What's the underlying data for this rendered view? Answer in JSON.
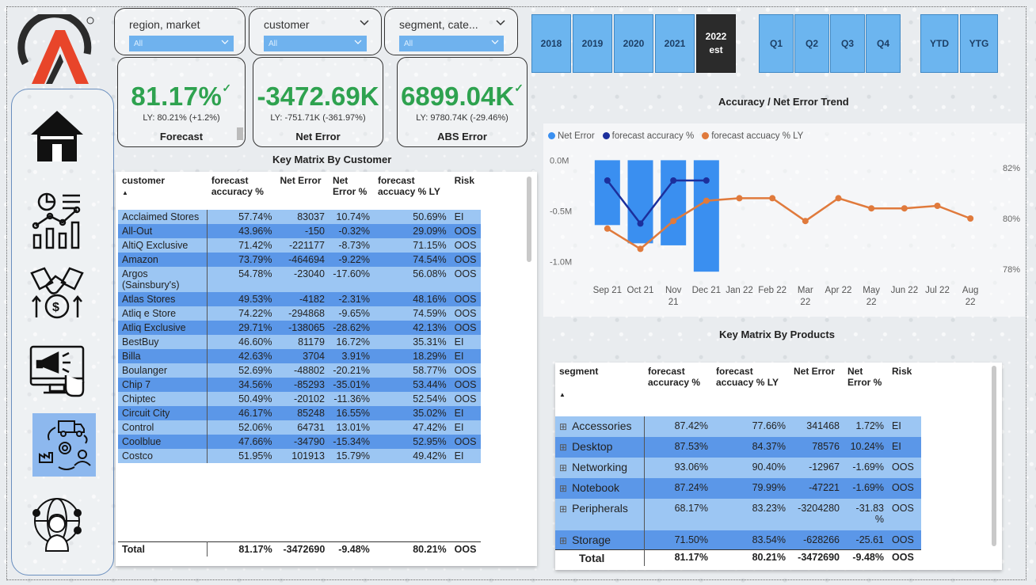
{
  "slicers": [
    {
      "label": "region, market",
      "value": "All"
    },
    {
      "label": "customer",
      "value": "All"
    },
    {
      "label": "segment, cate...",
      "value": "All"
    }
  ],
  "kpis": [
    {
      "value": "81.17%",
      "ly": "LY: 80.21% (+1.2%)",
      "name": "Forecast",
      "check": "✓"
    },
    {
      "value": "-3472.69K",
      "ly": "LY: -751.71K (-361.97%)",
      "name": "Net Error"
    },
    {
      "value": "6899.04K",
      "ly": "LY: 9780.74K (-29.46%)",
      "name": "ABS Error",
      "check": "✓"
    }
  ],
  "periods": [
    {
      "label": "2018",
      "selected": false
    },
    {
      "label": "2019",
      "selected": false
    },
    {
      "label": "2020",
      "selected": false
    },
    {
      "label": "2021",
      "selected": false
    },
    {
      "label": "2022",
      "sub": "est",
      "selected": true
    },
    {
      "label": "Q1"
    },
    {
      "label": "Q2"
    },
    {
      "label": "Q3"
    },
    {
      "label": "Q4"
    },
    {
      "label": "YTD"
    },
    {
      "label": "YTG"
    }
  ],
  "customer_table": {
    "title": "Key Matrix By Customer",
    "headers": [
      "customer",
      "forecast accuracy %",
      "Net Error",
      "Net Error %",
      "forecast accuacy % LY",
      "Risk"
    ],
    "rows": [
      [
        "Acclaimed Stores",
        "57.74%",
        "83037",
        "10.74%",
        "50.69%",
        "EI"
      ],
      [
        "All-Out",
        "43.96%",
        "-150",
        "-0.32%",
        "29.09%",
        "OOS"
      ],
      [
        "AltiQ Exclusive",
        "71.42%",
        "-221177",
        "-8.73%",
        "71.15%",
        "OOS"
      ],
      [
        "Amazon",
        "73.79%",
        "-464694",
        "-9.22%",
        "74.54%",
        "OOS"
      ],
      [
        "Argos (Sainsbury's)",
        "54.78%",
        "-23040",
        "-17.60%",
        "56.08%",
        "OOS"
      ],
      [
        "Atlas Stores",
        "49.53%",
        "-4182",
        "-2.31%",
        "48.16%",
        "OOS"
      ],
      [
        "Atliq e Store",
        "74.22%",
        "-294868",
        "-9.65%",
        "74.59%",
        "OOS"
      ],
      [
        "Atliq Exclusive",
        "29.71%",
        "-138065",
        "-28.62%",
        "42.13%",
        "OOS"
      ],
      [
        "BestBuy",
        "46.60%",
        "81179",
        "16.72%",
        "35.31%",
        "EI"
      ],
      [
        "Billa",
        "42.63%",
        "3704",
        "3.91%",
        "18.29%",
        "EI"
      ],
      [
        "Boulanger",
        "52.69%",
        "-48802",
        "-20.21%",
        "58.77%",
        "OOS"
      ],
      [
        "Chip 7",
        "34.56%",
        "-85293",
        "-35.01%",
        "53.44%",
        "OOS"
      ],
      [
        "Chiptec",
        "50.49%",
        "-20102",
        "-11.36%",
        "52.54%",
        "OOS"
      ],
      [
        "Circuit City",
        "46.17%",
        "85248",
        "16.55%",
        "35.02%",
        "EI"
      ],
      [
        "Control",
        "52.06%",
        "64731",
        "13.01%",
        "47.42%",
        "EI"
      ],
      [
        "Coolblue",
        "47.66%",
        "-34790",
        "-15.34%",
        "52.95%",
        "OOS"
      ],
      [
        "Costco",
        "51.95%",
        "101913",
        "15.79%",
        "49.42%",
        "EI"
      ]
    ],
    "total": [
      "Total",
      "81.17%",
      "-3472690",
      "-9.48%",
      "80.21%",
      "OOS"
    ]
  },
  "product_table": {
    "title": "Key Matrix By Products",
    "headers": [
      "segment",
      "forecast accuracy %",
      "forecast accuacy % LY",
      "Net Error",
      "Net Error %",
      "Risk"
    ],
    "rows": [
      [
        "Accessories",
        "87.42%",
        "77.66%",
        "341468",
        "1.72%",
        "EI"
      ],
      [
        "Desktop",
        "87.53%",
        "84.37%",
        "78576",
        "10.24%",
        "EI"
      ],
      [
        "Networking",
        "93.06%",
        "90.40%",
        "-12967",
        "-1.69%",
        "OOS"
      ],
      [
        "Notebook",
        "87.24%",
        "79.99%",
        "-47221",
        "-1.69%",
        "OOS"
      ],
      [
        "Peripherals",
        "68.17%",
        "83.23%",
        "-3204280",
        "-31.83 %",
        "OOS"
      ],
      [
        "Storage",
        "71.50%",
        "83.54%",
        "-628266",
        "-25.61",
        "OOS"
      ]
    ],
    "total": [
      "Total",
      "81.17%",
      "80.21%",
      "-3472690",
      "-9.48%",
      "OOS"
    ]
  },
  "chart": {
    "title": "Accuracy / Net Error Trend",
    "legend": [
      "Net Error",
      "forecast accuracy %",
      "forecast accuacy % LY"
    ]
  },
  "chart_data": {
    "type": "bar",
    "title": "Accuracy / Net Error Trend",
    "categories": [
      "Sep 21",
      "Oct 21",
      "Nov 21",
      "Dec 21",
      "Jan 22",
      "Feb 22",
      "Mar 22",
      "Apr 22",
      "May 22",
      "Jun 22",
      "Jul 22",
      "Aug 22"
    ],
    "y_left_ticks": [
      "0.0M",
      "-0.5M",
      "-1.0M"
    ],
    "y_right_ticks": [
      "82%",
      "80%",
      "78%"
    ],
    "y_left_range": [
      -1.2,
      0.05
    ],
    "y_right_range": [
      77.5,
      82.5
    ],
    "series": [
      {
        "name": "Net Error",
        "kind": "bar",
        "axis": "left",
        "color": "#3a8ff0",
        "values": [
          -0.64,
          -0.82,
          -0.84,
          -1.1,
          null,
          null,
          null,
          null,
          null,
          null,
          null,
          null
        ]
      },
      {
        "name": "forecast accuracy %",
        "kind": "line",
        "axis": "right",
        "color": "#1c2f9c",
        "values": [
          81.5,
          79.8,
          81.5,
          81.5,
          null,
          null,
          null,
          null,
          null,
          null,
          null,
          null
        ]
      },
      {
        "name": "forecast accuacy % LY",
        "kind": "line",
        "axis": "right",
        "color": "#e07a3c",
        "values": [
          79.6,
          78.8,
          79.9,
          80.7,
          80.8,
          80.8,
          79.9,
          80.8,
          80.4,
          80.4,
          80.5,
          80.0
        ]
      }
    ]
  },
  "colors": {
    "kpi_green": "#2ea24f",
    "row_light": "#9cc6f3",
    "row_dark": "#5b97e8",
    "period_button": "#6cb5ef",
    "period_selected": "#2b2b2b"
  },
  "icons": [
    "logo-icon",
    "home-icon",
    "analytics-icon",
    "deal-icon",
    "marketing-icon",
    "supply-chain-icon",
    "support-icon"
  ]
}
